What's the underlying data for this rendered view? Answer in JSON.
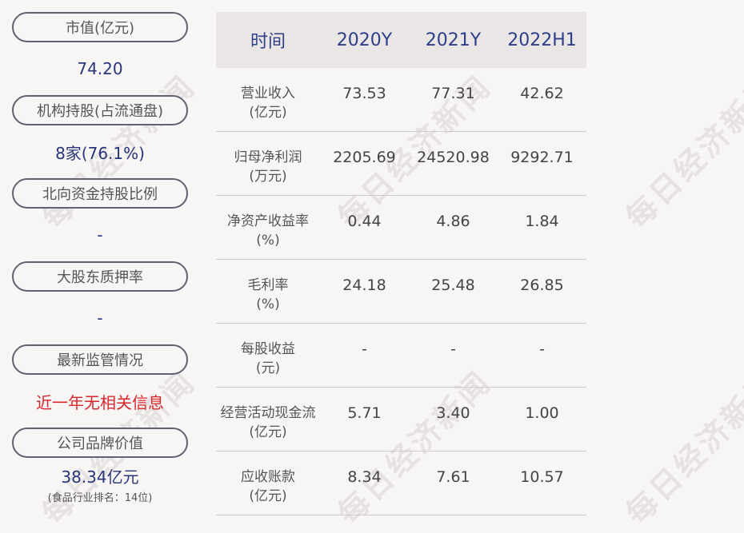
{
  "left": {
    "items": [
      {
        "label": "市值(亿元)",
        "value": "74.20"
      },
      {
        "label": "机构持股(占流通盘)",
        "value": "8家(76.1%)"
      },
      {
        "label": "北向资金持股比例",
        "value": "-"
      },
      {
        "label": "大股东质押率",
        "value": "-"
      },
      {
        "label": "最新监管情况",
        "value": "近一年无相关信息"
      },
      {
        "label": "公司品牌价值",
        "value": "38.34亿元",
        "sub": "(食品行业排名：14位)"
      }
    ]
  },
  "table": {
    "headers": [
      "时间",
      "2020Y",
      "2021Y",
      "2022H1"
    ],
    "rows": [
      {
        "label1": "营业收入",
        "label2": "(亿元)",
        "v": [
          "73.53",
          "77.31",
          "42.62"
        ]
      },
      {
        "label1": "归母净利润",
        "label2": "(万元)",
        "v": [
          "2205.69",
          "24520.98",
          "9292.71"
        ]
      },
      {
        "label1": "净资产收益率",
        "label2": "(%)",
        "v": [
          "0.44",
          "4.86",
          "1.84"
        ]
      },
      {
        "label1": "毛利率",
        "label2": "(%)",
        "v": [
          "24.18",
          "25.48",
          "26.85"
        ]
      },
      {
        "label1": "每股收益",
        "label2": "(元)",
        "v": [
          "-",
          "-",
          "-"
        ]
      },
      {
        "label1": "经营活动现金流",
        "label2": "(亿元)",
        "v": [
          "5.71",
          "3.40",
          "1.00"
        ]
      },
      {
        "label1": "应收账款",
        "label2": "(亿元)",
        "v": [
          "8.34",
          "7.61",
          "10.57"
        ]
      }
    ]
  },
  "watermark": "每日经济新闻",
  "colors": {
    "accent_blue": "#28367a",
    "header_blue": "#2c3f88",
    "alert_red": "#d8262c",
    "header_bg": "#ebe6e6"
  }
}
